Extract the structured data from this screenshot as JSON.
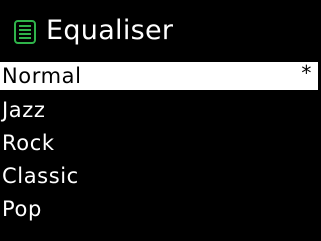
{
  "header": {
    "title": "Equaliser",
    "icon": "equaliser-menu-icon",
    "icon_color": "#2fb34a"
  },
  "menu": {
    "items": [
      {
        "label": "Normal",
        "marker": "*",
        "selected": true
      },
      {
        "label": "Jazz",
        "marker": "",
        "selected": false
      },
      {
        "label": "Rock",
        "marker": "",
        "selected": false
      },
      {
        "label": "Classic",
        "marker": "",
        "selected": false
      },
      {
        "label": "Pop",
        "marker": "",
        "selected": false
      }
    ]
  }
}
